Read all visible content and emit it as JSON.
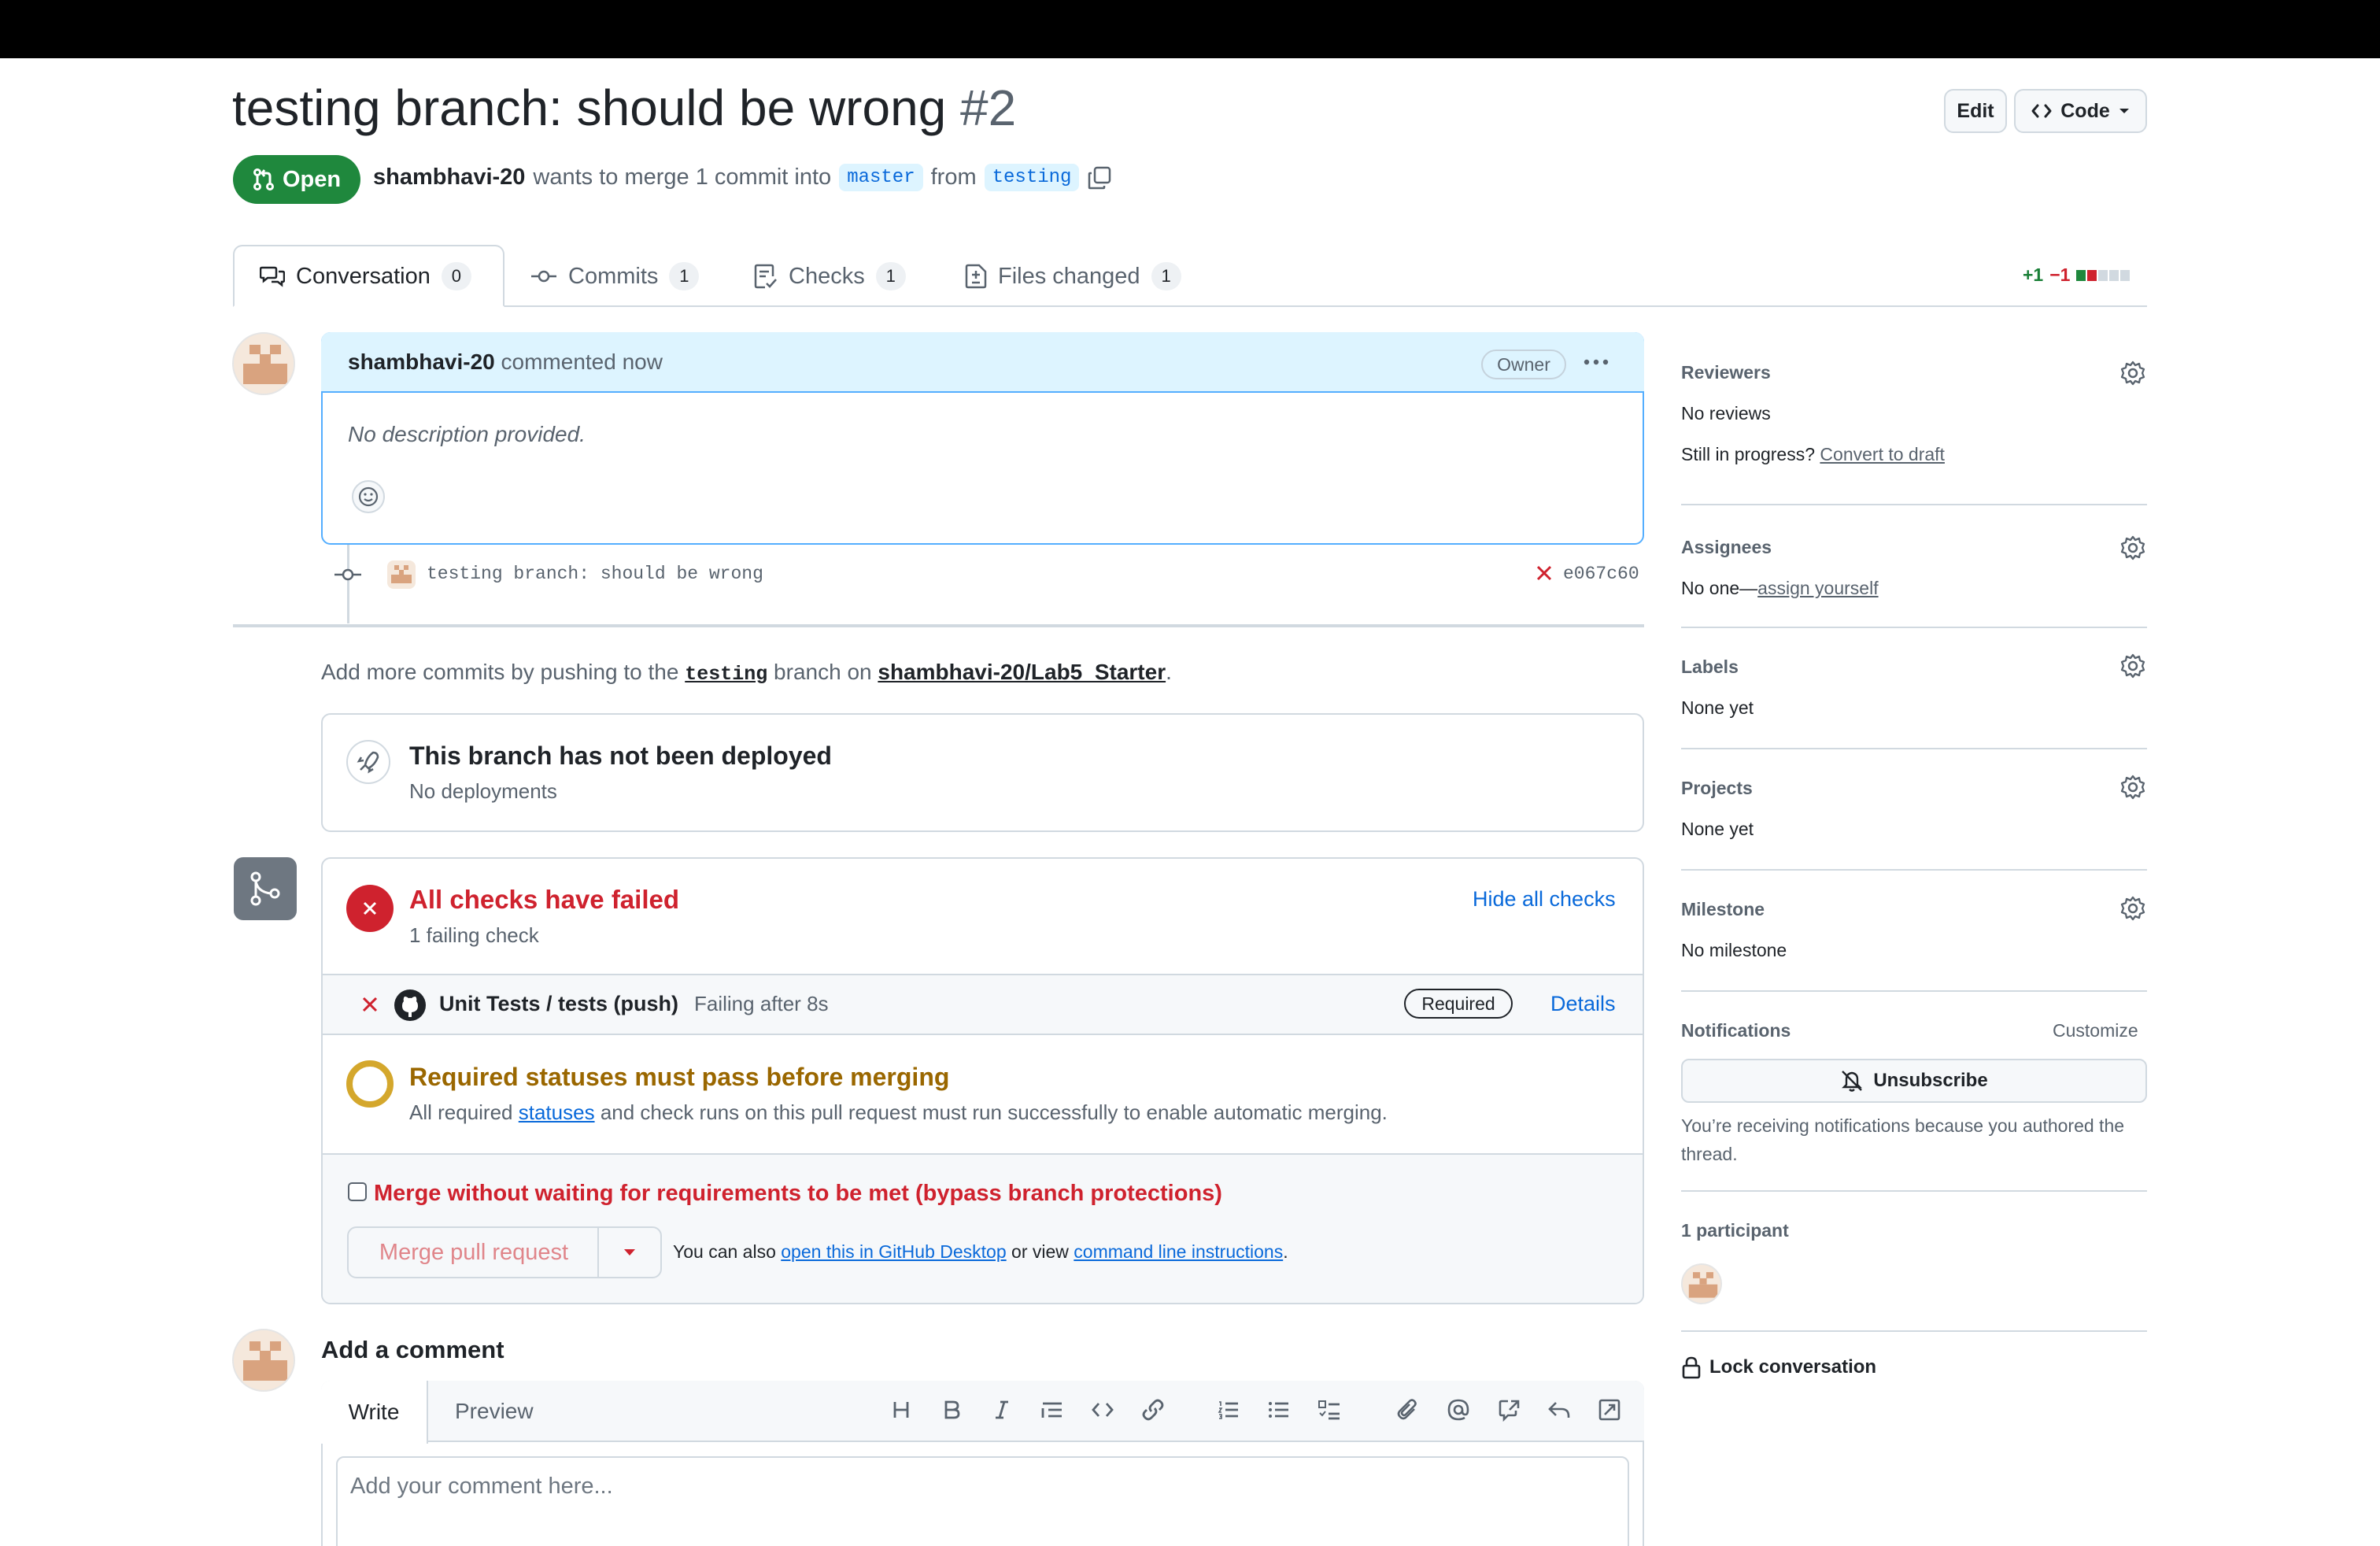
{
  "header": {
    "title": "testing branch: should be wrong",
    "number": "#2",
    "edit_label": "Edit",
    "code_label": "Code",
    "state_label": "Open",
    "author": "shambhavi-20",
    "merge_text": "wants to merge 1 commit into",
    "base_branch": "master",
    "from_text": "from",
    "head_branch": "testing"
  },
  "tabs": [
    {
      "label": "Conversation",
      "count": "0"
    },
    {
      "label": "Commits",
      "count": "1"
    },
    {
      "label": "Checks",
      "count": "1"
    },
    {
      "label": "Files changed",
      "count": "1"
    }
  ],
  "diffstat": {
    "additions": "+1",
    "deletions": "−1"
  },
  "comment": {
    "author": "shambhavi-20",
    "meta": "commented now",
    "role": "Owner",
    "body": "No description provided."
  },
  "commit": {
    "message": "testing branch: should be wrong",
    "sha": "e067c60"
  },
  "push_hint": {
    "prefix": "Add more commits by pushing to the",
    "branch": "testing",
    "middle": "branch on",
    "repo": "shambhavi-20/Lab5_Starter",
    "suffix": "."
  },
  "deploy": {
    "title": "This branch has not been deployed",
    "subtitle": "No deployments"
  },
  "checks": {
    "title": "All checks have failed",
    "subtitle": "1 failing check",
    "hide_label": "Hide all checks",
    "row_name": "Unit Tests / tests (push)",
    "row_status": "Failing after 8s",
    "required_label": "Required",
    "details_label": "Details",
    "colors": {
      "fail": "#cf222e",
      "pending": "#d4a72c",
      "link": "#0969da"
    }
  },
  "required": {
    "title": "Required statuses must pass before merging",
    "text_prefix": "All required",
    "text_link": "statuses",
    "text_suffix": "and check runs on this pull request must run successfully to enable automatic merging."
  },
  "merge": {
    "bypass_label": "Merge without waiting for requirements to be met (bypass branch protections)",
    "button_label": "Merge pull request",
    "also_prefix": "You can also",
    "desktop_link": "open this in GitHub Desktop",
    "or_view": "or view",
    "cli_link": "command line instructions",
    "suffix": "."
  },
  "add_comment": {
    "heading": "Add a comment",
    "write_tab": "Write",
    "preview_tab": "Preview",
    "placeholder": "Add your comment here..."
  },
  "sidebar": {
    "reviewers": {
      "title": "Reviewers",
      "value": "No reviews",
      "progress_text": "Still in progress?",
      "draft_link": "Convert to draft"
    },
    "assignees": {
      "title": "Assignees",
      "value_prefix": "No one—",
      "assign_link": "assign yourself"
    },
    "labels": {
      "title": "Labels",
      "value": "None yet"
    },
    "projects": {
      "title": "Projects",
      "value": "None yet"
    },
    "milestone": {
      "title": "Milestone",
      "value": "No milestone"
    },
    "notifications": {
      "title": "Notifications",
      "customize": "Customize",
      "button": "Unsubscribe",
      "reason": "You’re receiving notifications because you authored the thread."
    },
    "participants": {
      "title": "1 participant"
    },
    "lock_label": "Lock conversation"
  }
}
